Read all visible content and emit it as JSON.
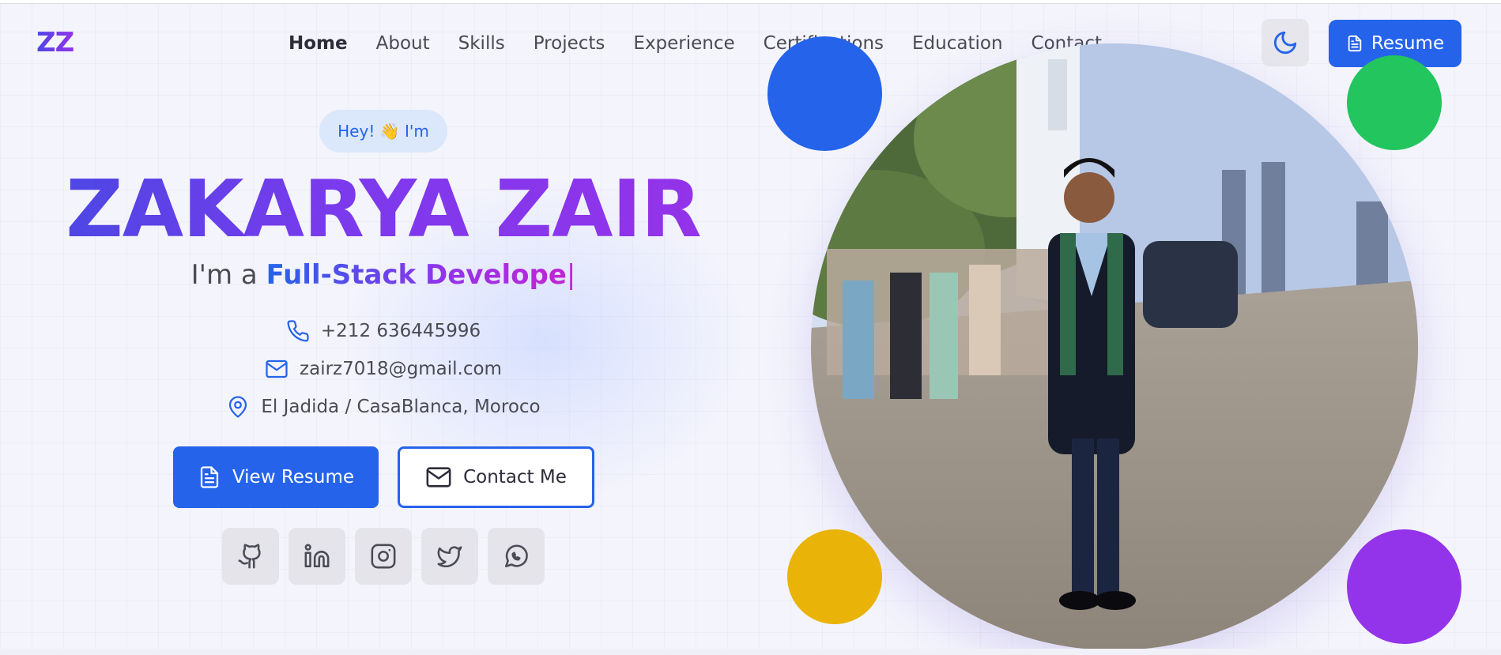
{
  "header": {
    "logo": "ZZ",
    "nav": [
      "Home",
      "About",
      "Skills",
      "Projects",
      "Experience",
      "Certifications",
      "Education",
      "Contact"
    ],
    "active_nav": "Home",
    "resume_label": "Resume"
  },
  "hero": {
    "greeting": "Hey! 👋 I'm",
    "name": "ZAKARYA ZAIR",
    "tagline_prefix": "I'm a",
    "tagline_role": "Full-Stack Develope",
    "tagline_cursor": "|",
    "phone": "+212 636445996",
    "email": "zairz7018@gmail.com",
    "location": "El Jadida / CasaBlanca, Moroco",
    "view_resume_label": "View Resume",
    "contact_label": "Contact Me",
    "socials": [
      "github-icon",
      "linkedin-icon",
      "instagram-icon",
      "twitter-icon",
      "whatsapp-icon"
    ]
  },
  "colors": {
    "primary": "#2563eb",
    "accent_purple": "#9333ea",
    "accent_green": "#22c55e",
    "accent_yellow": "#eab308"
  }
}
